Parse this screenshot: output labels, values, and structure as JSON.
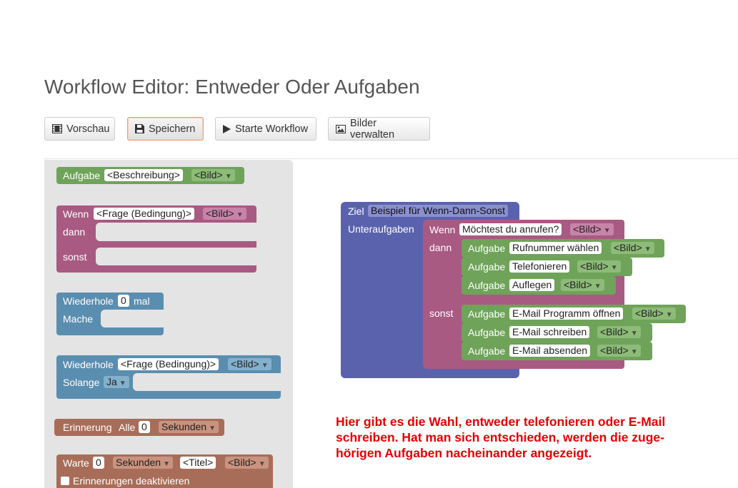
{
  "page": {
    "title": "Workflow Editor: Entweder Oder Aufgaben"
  },
  "toolbar": {
    "preview": {
      "label": "Vorschau",
      "icon": "film-icon"
    },
    "save": {
      "label": "Speichern",
      "icon": "floppy-icon"
    },
    "start": {
      "label": "Starte Workflow",
      "icon": "play-icon"
    },
    "images": {
      "label": "Bilder verwalten",
      "icon": "picture-icon"
    }
  },
  "toolbox": {
    "task": {
      "label": "Aufgabe",
      "desc": "<Beschreibung>",
      "image": "<Bild>"
    },
    "ifelse": {
      "if": "Wenn",
      "cond": "<Frage (Bedingung)>",
      "image": "<Bild>",
      "then": "dann",
      "else": "sonst"
    },
    "repeat": {
      "label": "Wiederhole",
      "count": "0",
      "unit": "mal",
      "do": "Mache"
    },
    "while": {
      "label": "Wiederhole",
      "cond": "<Frage (Bedingung)>",
      "image": "<Bild>",
      "until": "Solange",
      "value": "Ja"
    },
    "reminder": {
      "label": "Erinnerung",
      "all": "Alle",
      "count": "0",
      "unit": "Sekunden"
    },
    "wait": {
      "label": "Warte",
      "count": "0",
      "unit": "Sekunden",
      "title": "<Titel>",
      "image": "<Bild>",
      "checkbox": "Erinnerungen deaktivieren"
    }
  },
  "workspace": {
    "goal": {
      "label": "Ziel",
      "name": "Beispiel für Wenn-Dann-Sonst",
      "subtasks": "Unteraufgaben"
    },
    "ifelse": {
      "if": "Wenn",
      "question": "Möchtest du anrufen?",
      "image": "<Bild>",
      "then": "dann",
      "else": "sonst"
    },
    "task_label": "Aufgabe",
    "then_tasks": [
      {
        "name": "Rufnummer wählen",
        "image": "<Bild>"
      },
      {
        "name": "Telefonieren",
        "image": "<Bild>"
      },
      {
        "name": "Auflegen",
        "image": "<Bild>"
      }
    ],
    "else_tasks": [
      {
        "name": "E-Mail Programm öffnen",
        "image": "<Bild>"
      },
      {
        "name": "E-Mail schreiben",
        "image": "<Bild>"
      },
      {
        "name": "E-Mail absenden",
        "image": "<Bild>"
      }
    ]
  },
  "note": {
    "lines": [
      "Hier gibt es die Wahl, entweder telefonieren oder E-Mail",
      "schreiben. Hat man sich entschieden, werden die zuge-",
      "hörigen Aufgaben nacheinander angezeigt."
    ],
    "color": "#e60000"
  },
  "colors": {
    "task": "#6fa35a",
    "logic": "#a85a82",
    "loop": "#5a8eb0",
    "time": "#a86d58",
    "goal": "#5b62ad"
  }
}
